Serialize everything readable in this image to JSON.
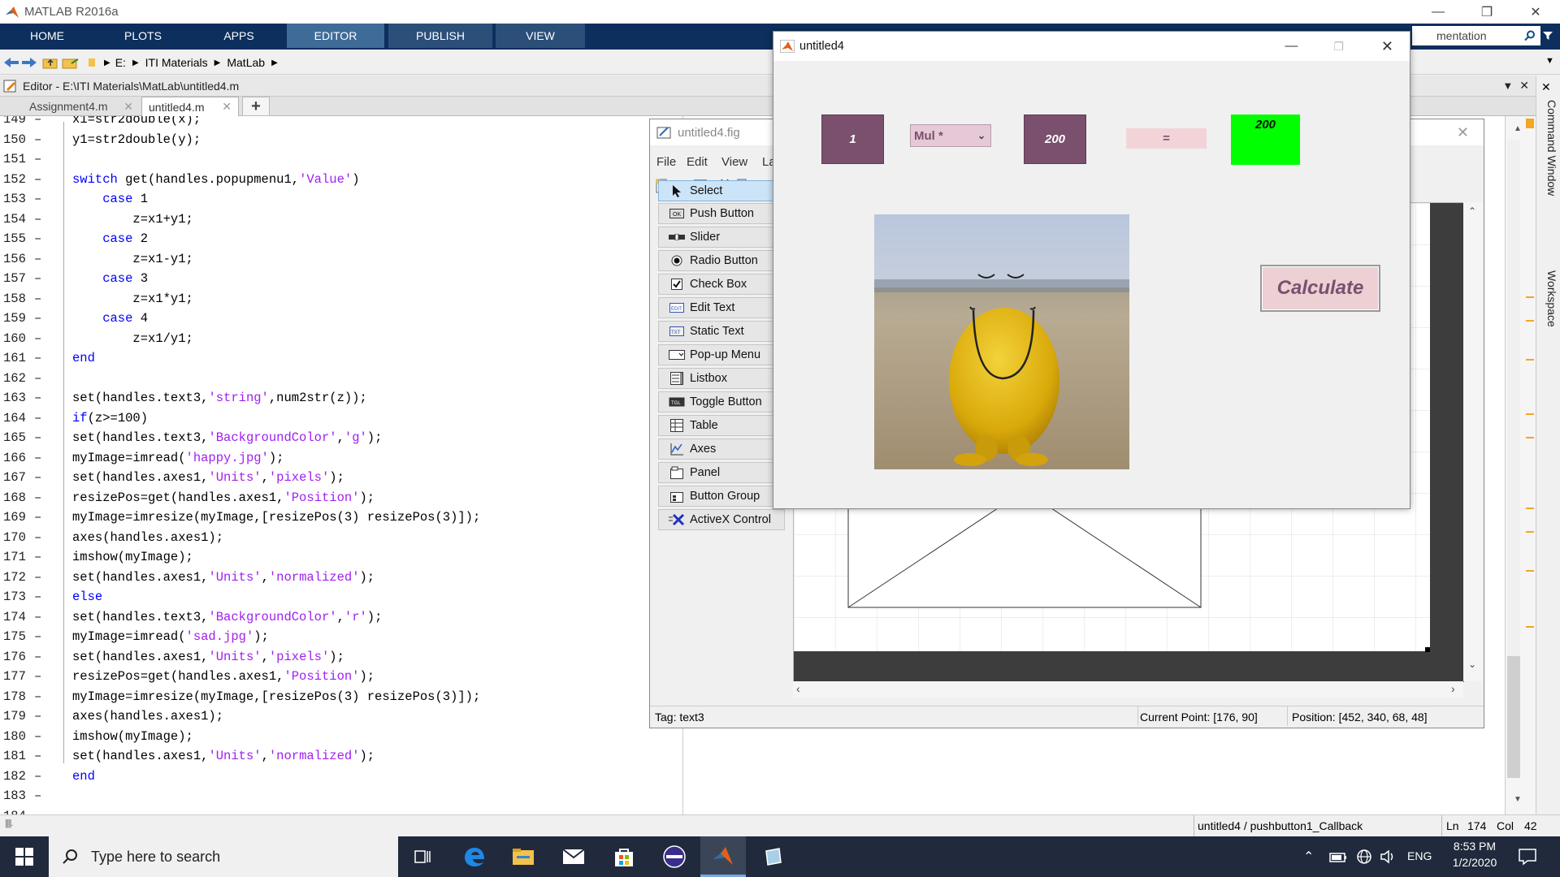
{
  "app": {
    "title": "MATLAB R2016a"
  },
  "ribbon": {
    "tabs": [
      "HOME",
      "PLOTS",
      "APPS",
      "EDITOR",
      "PUBLISH",
      "VIEW"
    ],
    "search_text": "mentation"
  },
  "address": {
    "parts": [
      "E:",
      "ITI Materials",
      "MatLab"
    ]
  },
  "editor": {
    "header": "Editor - E:\\ITI Materials\\MatLab\\untitled4.m",
    "tabs": [
      "Assignment4.m",
      "untitled4.m"
    ],
    "lines": [
      {
        "n": "149",
        "t": [
          [
            "x1=str2double(x);",
            ""
          ]
        ]
      },
      {
        "n": "150",
        "t": [
          [
            "y1=str2double(y);",
            ""
          ]
        ]
      },
      {
        "n": "151",
        "t": []
      },
      {
        "n": "152",
        "t": [
          [
            "switch",
            "k"
          ],
          [
            " get(handles.popupmenu1,",
            ""
          ],
          [
            "'Value'",
            "s"
          ],
          [
            ")",
            ""
          ]
        ]
      },
      {
        "n": "153",
        "t": [
          [
            "    case",
            "k"
          ],
          [
            " 1",
            ""
          ]
        ]
      },
      {
        "n": "154",
        "t": [
          [
            "        z=x1+y1;",
            ""
          ]
        ]
      },
      {
        "n": "155",
        "t": [
          [
            "    case",
            "k"
          ],
          [
            " 2",
            ""
          ]
        ]
      },
      {
        "n": "156",
        "t": [
          [
            "        z=x1-y1;",
            ""
          ]
        ]
      },
      {
        "n": "157",
        "t": [
          [
            "    case",
            "k"
          ],
          [
            " 3",
            ""
          ]
        ]
      },
      {
        "n": "158",
        "t": [
          [
            "        z=x1*y1;",
            ""
          ]
        ]
      },
      {
        "n": "159",
        "t": [
          [
            "    case",
            "k"
          ],
          [
            " 4",
            ""
          ]
        ]
      },
      {
        "n": "160",
        "t": [
          [
            "        z=x1/y1;",
            ""
          ]
        ]
      },
      {
        "n": "161",
        "t": [
          [
            "end",
            "k"
          ]
        ]
      },
      {
        "n": "162",
        "t": []
      },
      {
        "n": "163",
        "t": [
          [
            "set(handles.text3,",
            ""
          ],
          [
            "'string'",
            "s"
          ],
          [
            ",num2str(z));",
            ""
          ]
        ]
      },
      {
        "n": "164",
        "t": [
          [
            "if",
            "k"
          ],
          [
            "(z>=100)",
            ""
          ]
        ]
      },
      {
        "n": "165",
        "t": [
          [
            "set(handles.text3,",
            ""
          ],
          [
            "'BackgroundColor'",
            "s"
          ],
          [
            ",",
            ""
          ],
          [
            "'g'",
            "s"
          ],
          [
            ");",
            ""
          ]
        ]
      },
      {
        "n": "166",
        "t": [
          [
            "myImage=imread(",
            ""
          ],
          [
            "'happy.jpg'",
            "s"
          ],
          [
            ");",
            ""
          ]
        ]
      },
      {
        "n": "167",
        "t": [
          [
            "set(handles.axes1,",
            ""
          ],
          [
            "'Units'",
            "s"
          ],
          [
            ",",
            ""
          ],
          [
            "'pixels'",
            "s"
          ],
          [
            ");",
            ""
          ]
        ]
      },
      {
        "n": "168",
        "t": [
          [
            "resizePos=get(handles.axes1,",
            ""
          ],
          [
            "'Position'",
            "s"
          ],
          [
            ");",
            ""
          ]
        ]
      },
      {
        "n": "169",
        "t": [
          [
            "myImage=imresize(myImage,[resizePos(3) resizePos(3)]);",
            ""
          ]
        ]
      },
      {
        "n": "170",
        "t": [
          [
            "axes(handles.axes1);",
            ""
          ]
        ]
      },
      {
        "n": "171",
        "t": [
          [
            "imshow(myImage);",
            ""
          ]
        ]
      },
      {
        "n": "172",
        "t": [
          [
            "set(handles.axes1,",
            ""
          ],
          [
            "'Units'",
            "s"
          ],
          [
            ",",
            ""
          ],
          [
            "'normalized'",
            "s"
          ],
          [
            ");",
            ""
          ]
        ]
      },
      {
        "n": "173",
        "t": [
          [
            "else",
            "k"
          ]
        ]
      },
      {
        "n": "174",
        "t": [
          [
            "set(handles.text3,",
            ""
          ],
          [
            "'BackgroundColor'",
            "s"
          ],
          [
            ",",
            ""
          ],
          [
            "'r'",
            "s"
          ],
          [
            ");",
            ""
          ]
        ]
      },
      {
        "n": "175",
        "t": [
          [
            "myImage=imread(",
            ""
          ],
          [
            "'sad.jpg'",
            "s"
          ],
          [
            ");",
            ""
          ]
        ]
      },
      {
        "n": "176",
        "t": [
          [
            "set(handles.axes1,",
            ""
          ],
          [
            "'Units'",
            "s"
          ],
          [
            ",",
            ""
          ],
          [
            "'pixels'",
            "s"
          ],
          [
            ");",
            ""
          ]
        ]
      },
      {
        "n": "177",
        "t": [
          [
            "resizePos=get(handles.axes1,",
            ""
          ],
          [
            "'Position'",
            "s"
          ],
          [
            ");",
            ""
          ]
        ]
      },
      {
        "n": "178",
        "t": [
          [
            "myImage=imresize(myImage,[resizePos(3) resizePos(3)]);",
            ""
          ]
        ]
      },
      {
        "n": "179",
        "t": [
          [
            "axes(handles.axes1);",
            ""
          ]
        ]
      },
      {
        "n": "180",
        "t": [
          [
            "imshow(myImage);",
            ""
          ]
        ]
      },
      {
        "n": "181",
        "t": [
          [
            "set(handles.axes1,",
            ""
          ],
          [
            "'Units'",
            "s"
          ],
          [
            ",",
            ""
          ],
          [
            "'normalized'",
            "s"
          ],
          [
            ");",
            ""
          ]
        ]
      },
      {
        "n": "182",
        "t": [
          [
            "end",
            "k"
          ]
        ]
      },
      {
        "n": "183",
        "t": []
      },
      {
        "n": "184",
        "t": []
      }
    ]
  },
  "guide": {
    "title": "untitled4.fig",
    "menu": [
      "File",
      "Edit",
      "View",
      "La"
    ],
    "palette": [
      "Select",
      "Push Button",
      "Slider",
      "Radio Button",
      "Check Box",
      "Edit Text",
      "Static Text",
      "Pop-up Menu",
      "Listbox",
      "Toggle Button",
      "Table",
      "Axes",
      "Panel",
      "Button Group",
      "ActiveX Control"
    ],
    "status": {
      "tag": "Tag: text3",
      "current_point": "Current Point:  [176, 90]",
      "position": "Position: [452, 340, 68, 48]"
    }
  },
  "figure": {
    "title": "untitled4",
    "edit1": "1",
    "popup_value": "Mul *",
    "edit2": "200",
    "equals": "=",
    "result": "200",
    "calculate": "Calculate",
    "colors": {
      "edit_bg": "#7b4f6e",
      "result_bg": "#00ff00",
      "equals_bg": "#f2d4d8",
      "button_bg": "#ecd0d4"
    }
  },
  "side_panels": [
    "Command Window",
    "Workspace"
  ],
  "statusbar": {
    "function": "untitled4 / pushbutton1_Callback",
    "ln_label": "Ln",
    "ln": "174",
    "col_label": "Col",
    "col": "42"
  },
  "taskbar": {
    "search_placeholder": "Type here to search",
    "lang": "ENG",
    "time": "8:53 PM",
    "date": "1/2/2020"
  }
}
